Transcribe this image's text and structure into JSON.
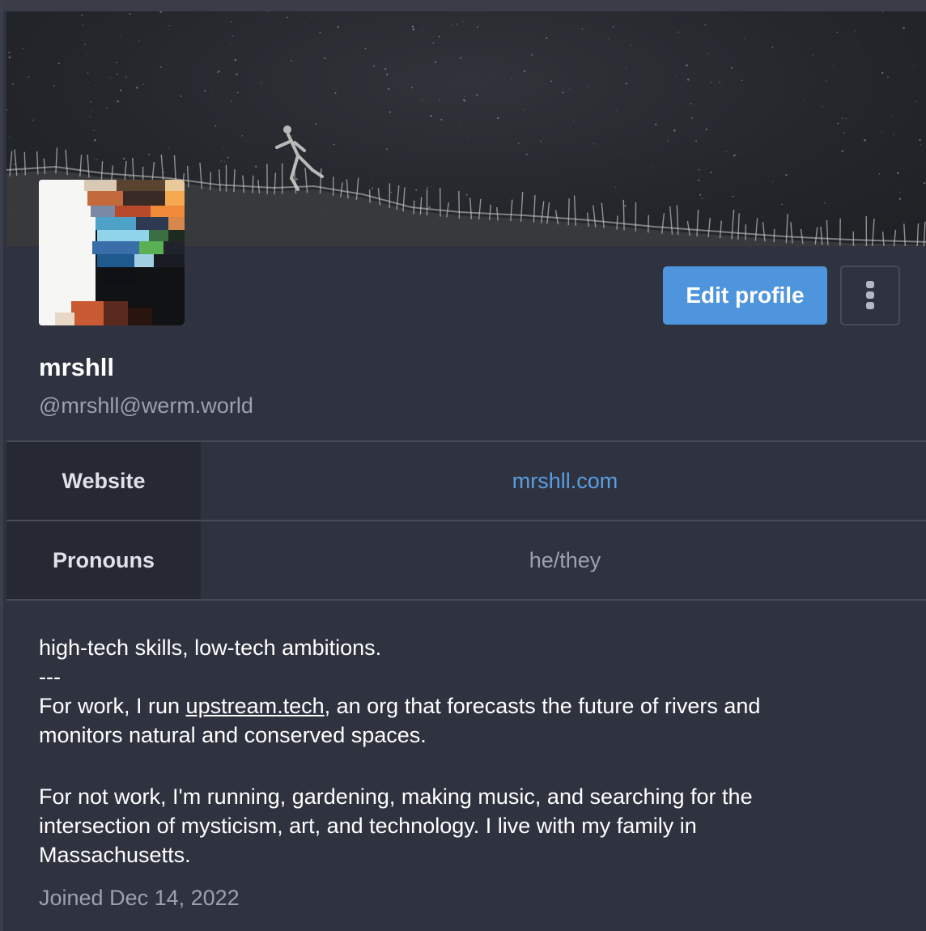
{
  "profile": {
    "display_name": "mrshll",
    "handle": "@mrshll@werm.world",
    "edit_button_label": "Edit profile",
    "more_icon": "kebab-vertical-icon",
    "joined": "Joined Dec 14, 2022"
  },
  "fields": [
    {
      "name": "Website",
      "value": "mrshll.com",
      "is_link": true
    },
    {
      "name": "Pronouns",
      "value": "he/they",
      "is_link": false
    }
  ],
  "bio": {
    "line1": "high-tech skills, low-tech ambitions.",
    "separator": "---",
    "work_prefix": "For work, I run ",
    "work_link": "upstream.tech",
    "work_suffix": ", an org that forecasts the future of rivers and monitors natural and conserved spaces.",
    "leisure": "For not work, I'm running, gardening, making music, and searching for the intersection of mysticism, art, and technology. I live with my family in Massachusetts."
  },
  "colors": {
    "background": "#2f3340",
    "accent": "#4f95de",
    "link": "#5a9ee2",
    "muted": "#9ba1b0",
    "field_label_bg": "#262933"
  }
}
